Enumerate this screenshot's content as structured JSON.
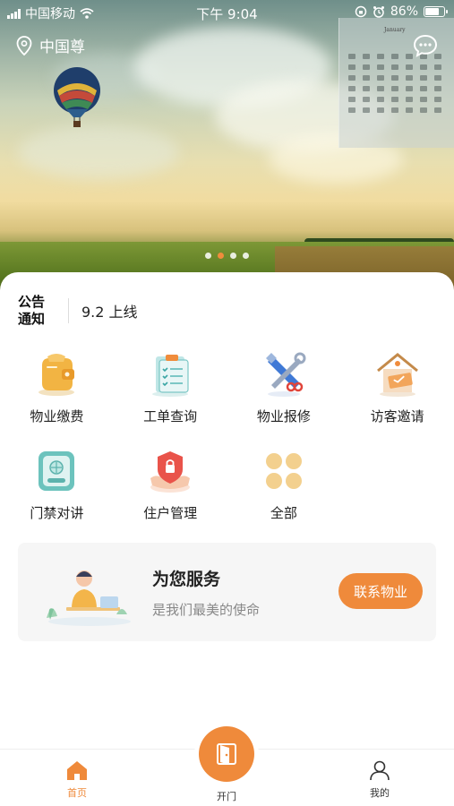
{
  "status_bar": {
    "carrier": "中国移动",
    "time": "下午 9:04",
    "battery": "86%",
    "battery_level": 0.86
  },
  "header": {
    "location": "中国尊"
  },
  "banner": {
    "calendar_text": "January",
    "dots_count": 4,
    "active_dot": 1
  },
  "notice": {
    "label": "公告\n通知",
    "text": "9.2 上线"
  },
  "services": [
    {
      "label": "物业缴费",
      "icon": "payment-icon"
    },
    {
      "label": "工单查询",
      "icon": "work-order-icon"
    },
    {
      "label": "物业报修",
      "icon": "repair-icon"
    },
    {
      "label": "访客邀请",
      "icon": "visitor-invite-icon"
    },
    {
      "label": "门禁对讲",
      "icon": "access-intercom-icon"
    },
    {
      "label": "住户管理",
      "icon": "resident-management-icon"
    },
    {
      "label": "全部",
      "icon": "all-services-icon"
    }
  ],
  "service_card": {
    "title": "为您服务",
    "subtitle": "是我们最美的使命",
    "button": "联系物业"
  },
  "tabbar": {
    "home": "首页",
    "open": "开门",
    "mine": "我的"
  },
  "colors": {
    "accent": "#ef8a3b"
  }
}
